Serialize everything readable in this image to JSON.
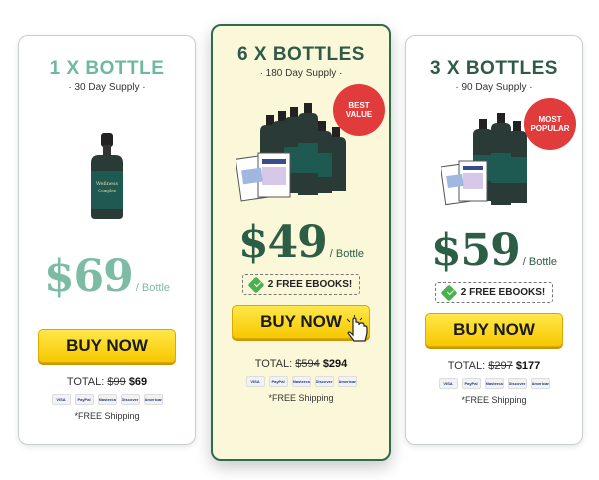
{
  "packages": [
    {
      "quantity": "1 X BOTTLE",
      "supply": "· 30 Day Supply ·",
      "price": "$69",
      "per": "/ Bottle",
      "buy_label": "BUY NOW",
      "total_label": "TOTAL:",
      "total_original": "$99",
      "total_price": "$69",
      "shipping": "*FREE Shipping"
    },
    {
      "quantity": "6 X BOTTLES",
      "supply": "· 180 Day Supply ·",
      "price": "$49",
      "per": "/ Bottle",
      "badge": "BEST VALUE",
      "ebook_label": "2 FREE EBOOKS!",
      "buy_label": "BUY NOW",
      "total_label": "TOTAL:",
      "total_original": "$594",
      "total_price": "$294",
      "shipping": "*FREE Shipping"
    },
    {
      "quantity": "3 X BOTTLES",
      "supply": "· 90 Day Supply ·",
      "price": "$59",
      "per": "/ Bottle",
      "badge": "MOST POPULAR",
      "ebook_label": "2 FREE EBOOKS!",
      "buy_label": "BUY NOW",
      "total_label": "TOTAL:",
      "total_original": "$297",
      "total_price": "$177",
      "shipping": "*FREE Shipping"
    }
  ],
  "payment_methods": [
    "VISA",
    "PayPal",
    "Mastercard",
    "Discover",
    "American Express"
  ],
  "colors": {
    "accent_light": "#7cbca4",
    "accent_dark": "#2c5e45",
    "button_yellow": "#f7c800",
    "badge_red": "#e23b3b",
    "featured_bg": "#fbf8da"
  },
  "icons": [
    "bottle-icon",
    "ebook-icon",
    "check-icon",
    "cursor-hand-icon",
    "payment-icon"
  ]
}
